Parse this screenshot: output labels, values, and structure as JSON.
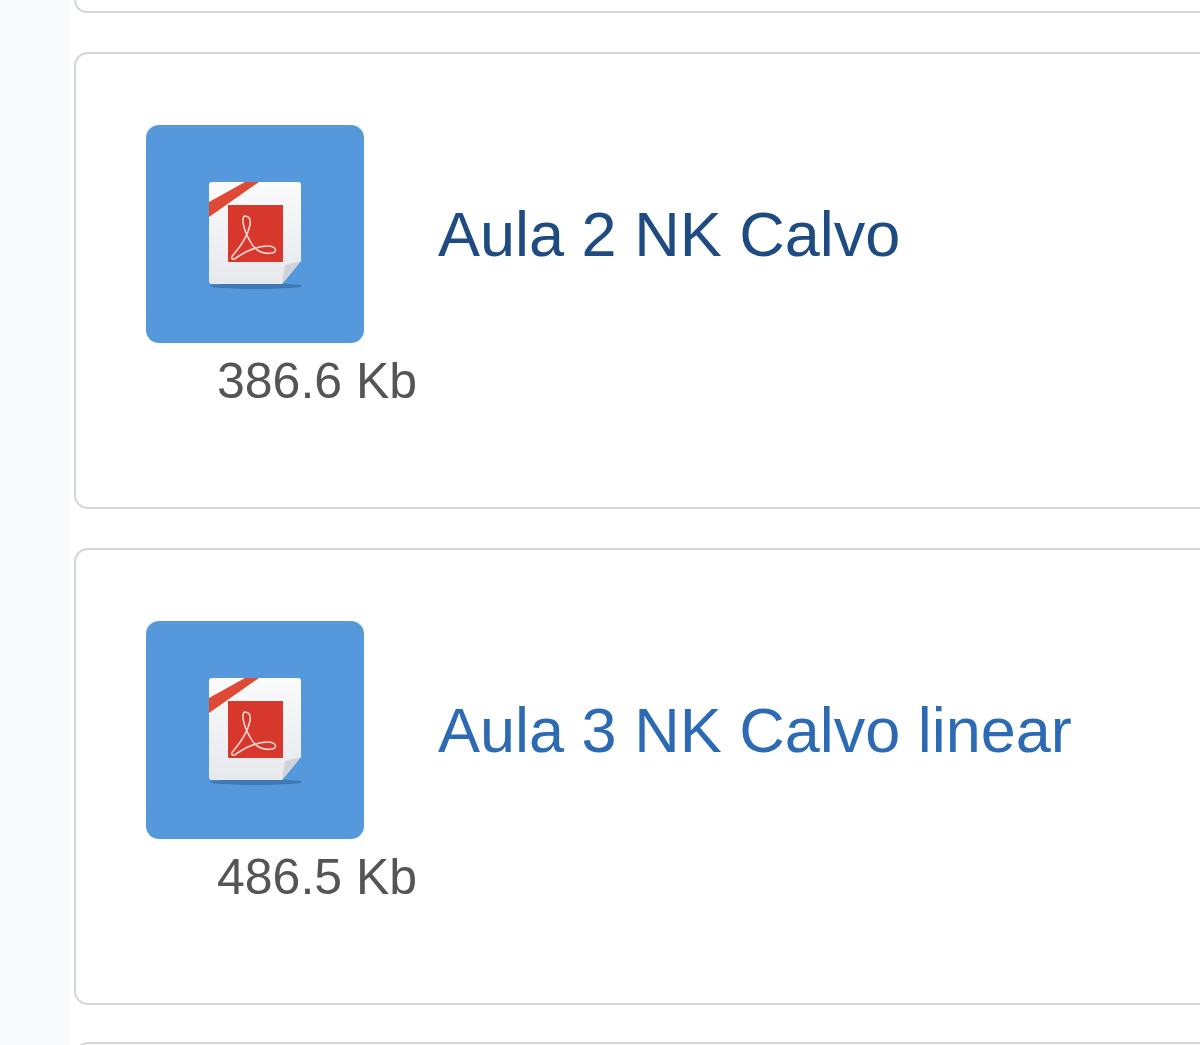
{
  "files": [
    {
      "title": "Aula 2 NK Calvo",
      "visited": true,
      "size": "386.6 Kb"
    },
    {
      "title": "Aula 3 NK Calvo linear",
      "visited": false,
      "size": "486.5 Kb"
    }
  ]
}
